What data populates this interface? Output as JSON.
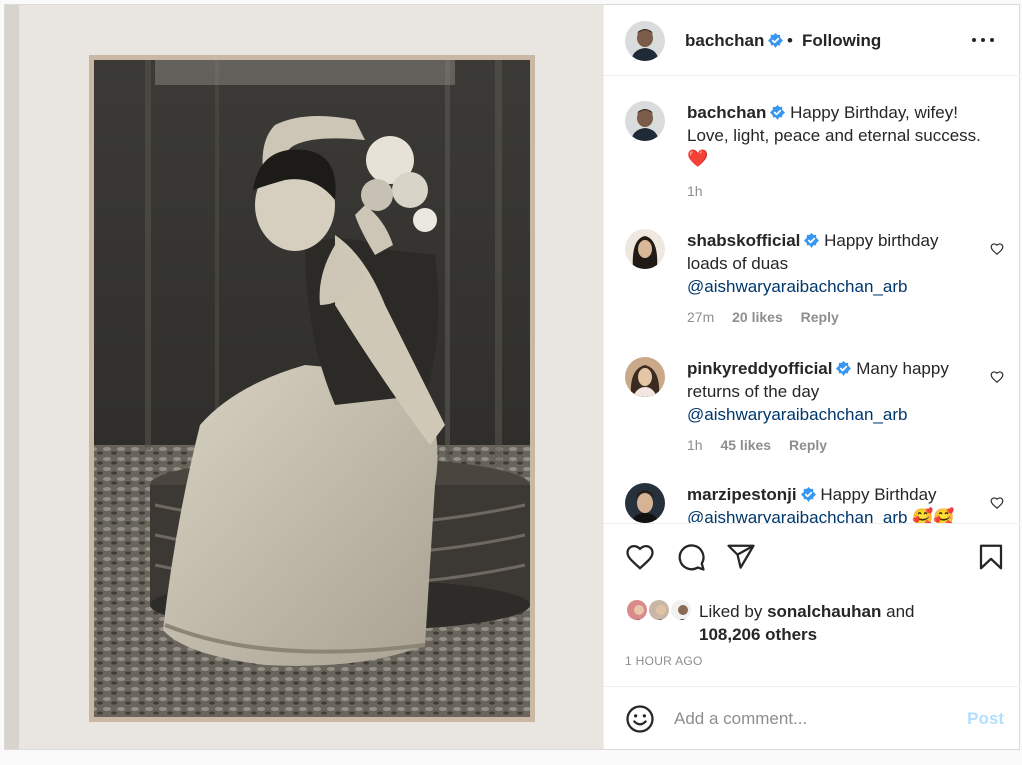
{
  "post": {
    "author": "bachchan",
    "follow_status": "Following",
    "dot": "•",
    "verified": true,
    "caption": {
      "username": "bachchan",
      "line1": "Happy Birthday, wifey!",
      "line2": "Love, light, peace and eternal success.",
      "emoji": "❤️",
      "time": "1h"
    },
    "comments": [
      {
        "username": "shabskofficial",
        "text": "Happy birthday loads of duas",
        "mention": "@aishwaryaraibachchan_arb",
        "time": "27m",
        "likes": "20 likes",
        "reply": "Reply"
      },
      {
        "username": "pinkyreddyofficial",
        "text": "Many happy returns of the day",
        "mention": "@aishwaryaraibachchan_arb",
        "time": "1h",
        "likes": "45 likes",
        "reply": "Reply"
      },
      {
        "username": "marzipestonji",
        "text": "Happy Birthday",
        "mention": "@aishwaryaraibachchan_arb",
        "emoji": "🥰🥰"
      }
    ],
    "likes": {
      "prefix": "Liked by",
      "user": "sonalchauhan",
      "and": "and",
      "others": "108,206 others"
    },
    "timestamp": "1 HOUR AGO",
    "add_comment_placeholder": "Add a comment...",
    "post_label": "Post"
  },
  "colors": {
    "verified": "#3897f0",
    "link": "#00376b",
    "muted": "#8e8e8e",
    "post_disabled": "#b2dffc",
    "heart": "#ed4956"
  },
  "icons": [
    "more-icon",
    "verified-icon",
    "heart-icon",
    "comment-icon",
    "share-icon",
    "bookmark-icon",
    "emoji-icon",
    "small-heart-icon"
  ]
}
